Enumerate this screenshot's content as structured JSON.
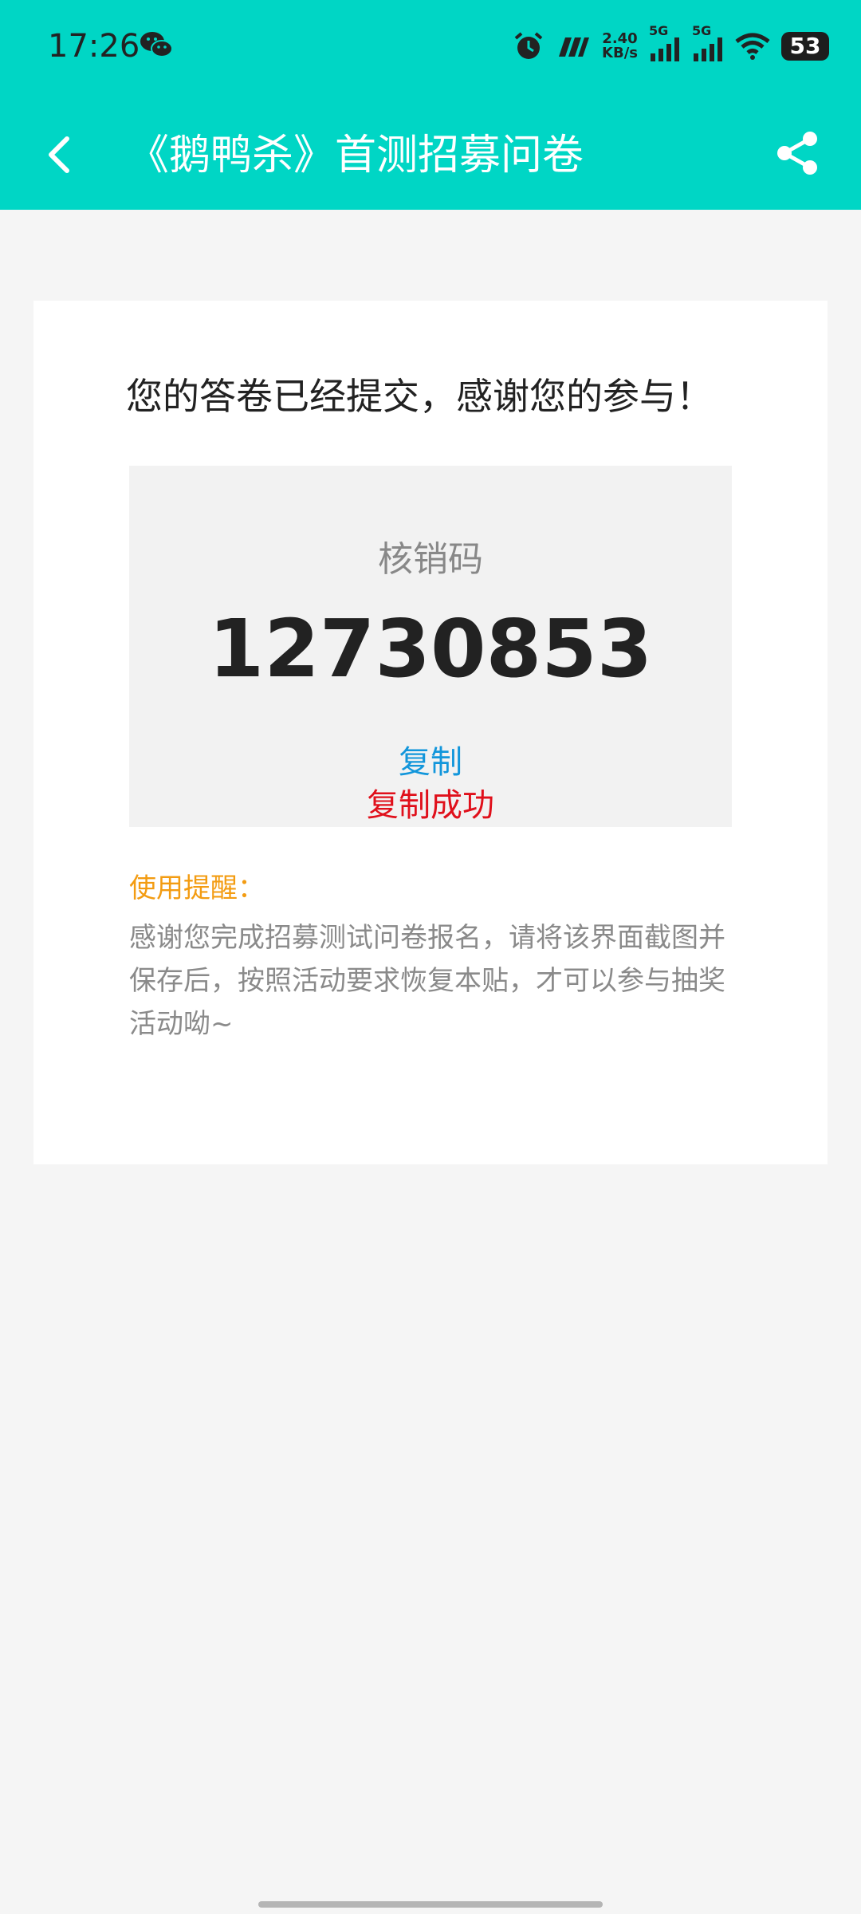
{
  "status_bar": {
    "time": "17:26",
    "net_speed_value": "2.40",
    "net_speed_unit": "KB/s",
    "sim1": "5G",
    "sim2": "5G",
    "battery": "53",
    "icons": [
      "wechat-icon",
      "alarm-icon",
      "carrier-icon",
      "signal-icon",
      "wifi-icon",
      "battery-icon"
    ]
  },
  "header": {
    "title": "《鹅鸭杀》首测招募问卷",
    "back_icon": "chevron-left-icon",
    "share_icon": "share-icon",
    "background": "#00d6c5"
  },
  "result": {
    "headline": "您的答卷已经提交，感谢您的参与！",
    "code_label": "核销码",
    "code_value": "12730853",
    "copy_label": "复制",
    "copy_success": "复制成功"
  },
  "notice": {
    "title": "使用提醒：",
    "body": "感谢您完成招募测试问卷报名，请将该界面截图并保存后，按照活动要求恢复本贴，才可以参与抽奖活动呦~"
  },
  "colors": {
    "accent": "#00d6c5",
    "link": "#1296db",
    "success": "#e0101b",
    "notice_title": "#f39c12"
  }
}
